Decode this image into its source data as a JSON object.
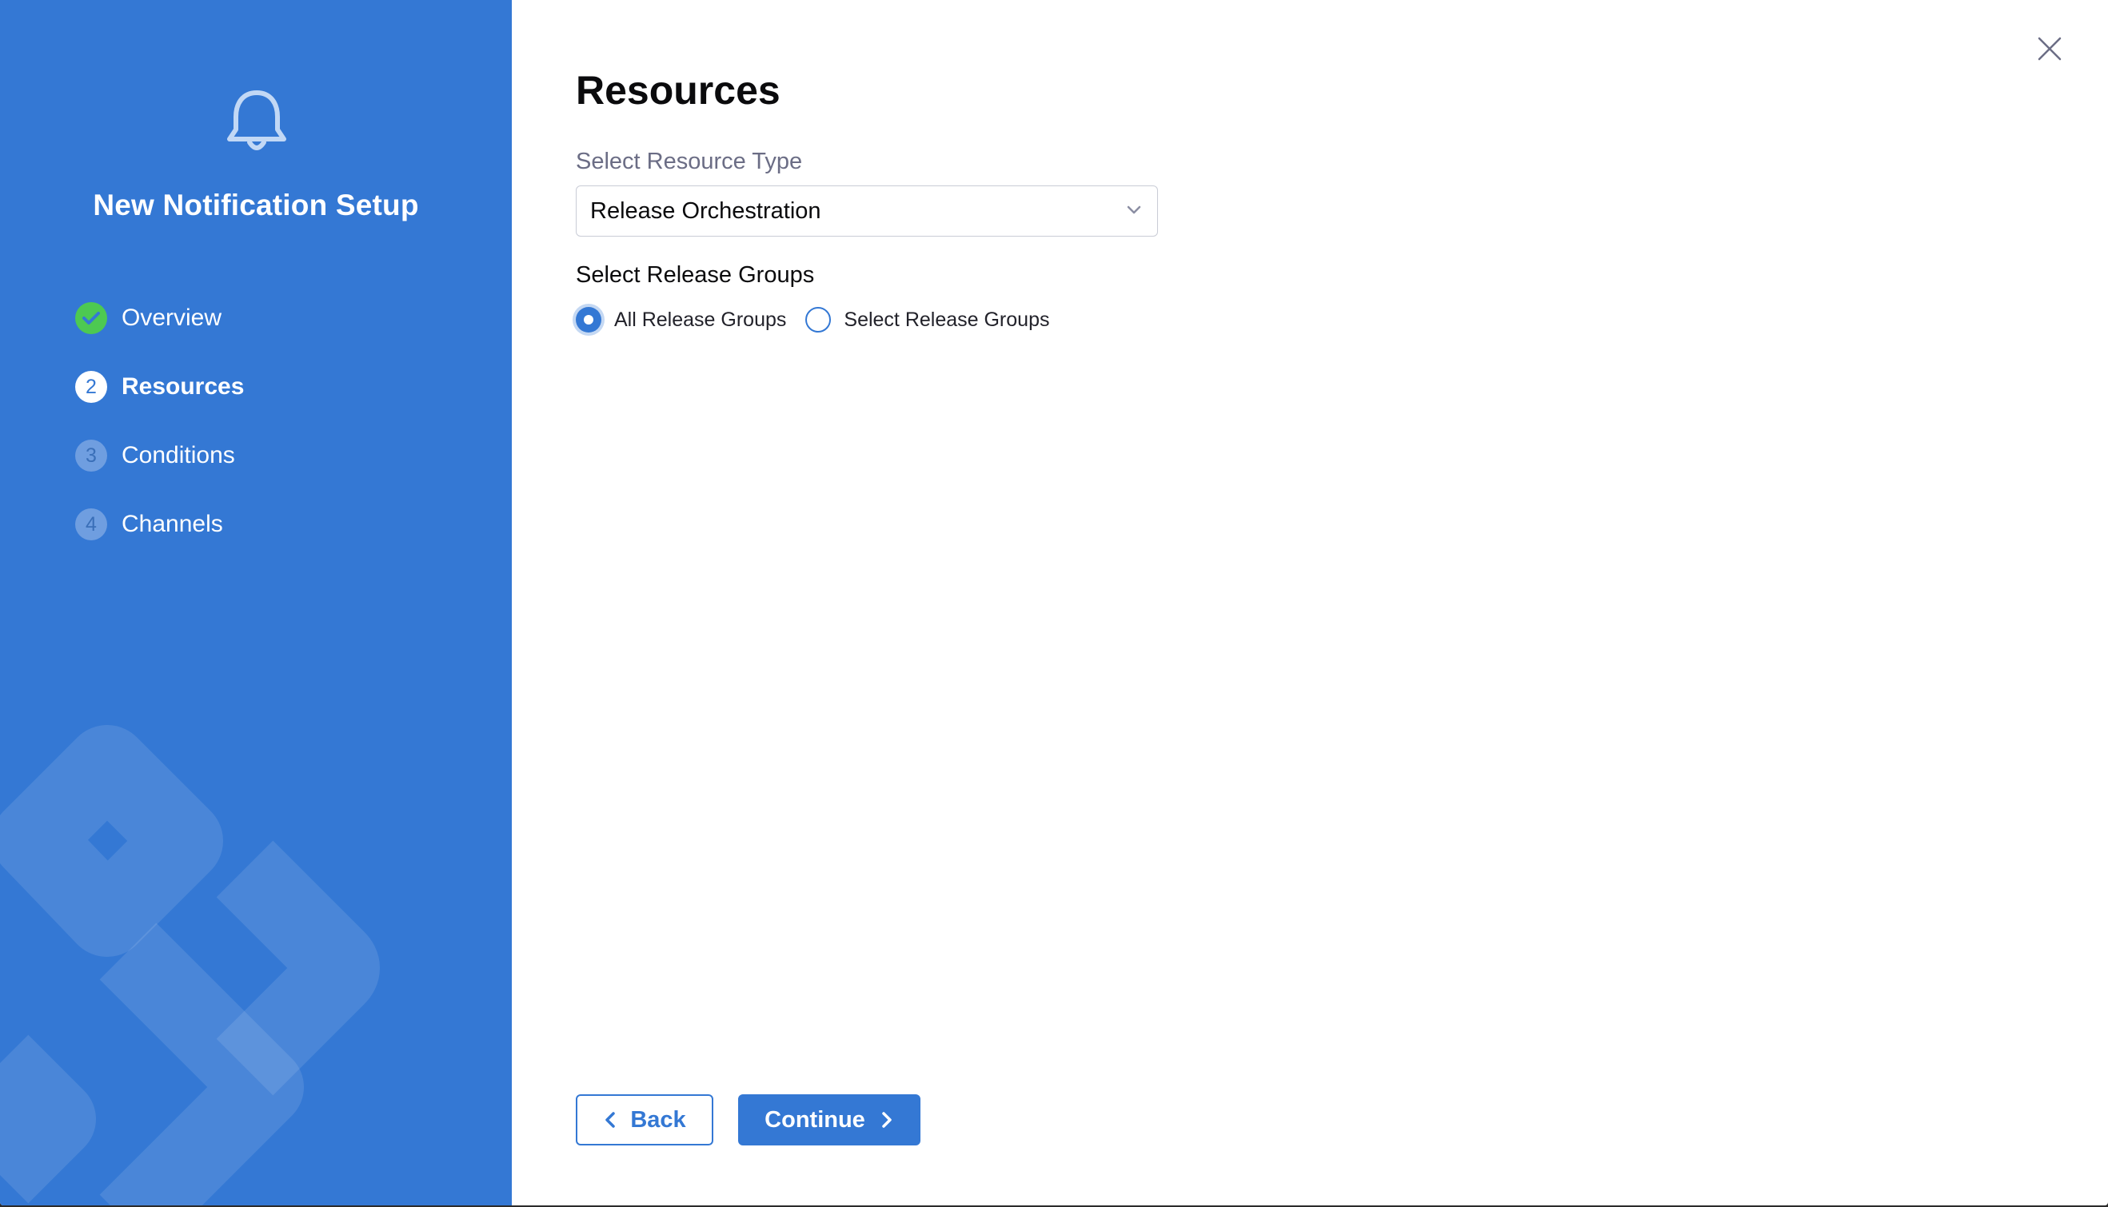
{
  "sidebar": {
    "title": "New Notification Setup",
    "steps": [
      {
        "number": "1",
        "label": "Overview",
        "state": "done"
      },
      {
        "number": "2",
        "label": "Resources",
        "state": "current"
      },
      {
        "number": "3",
        "label": "Conditions",
        "state": "pending"
      },
      {
        "number": "4",
        "label": "Channels",
        "state": "pending"
      }
    ],
    "icon": "bell-icon",
    "background_color": "#3478d4"
  },
  "main": {
    "title": "Resources",
    "resource_type": {
      "label": "Select Resource Type",
      "value": "Release Orchestration"
    },
    "release_groups": {
      "label": "Select Release Groups",
      "options": [
        {
          "label": "All Release Groups",
          "checked": true
        },
        {
          "label": "Select Release Groups",
          "checked": false
        }
      ]
    },
    "buttons": {
      "back_label": "Back",
      "continue_label": "Continue"
    }
  },
  "colors": {
    "accent": "#3478d4",
    "success": "#4dc952"
  }
}
